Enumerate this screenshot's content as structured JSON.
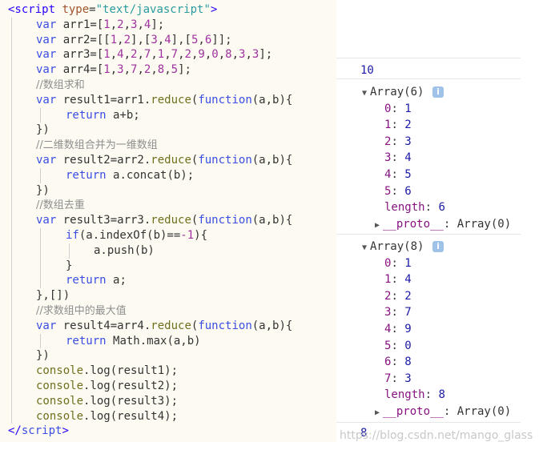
{
  "code": {
    "lines": [
      [
        [
          "tag",
          "<script "
        ],
        [
          "attr",
          "type"
        ],
        [
          "plain",
          "="
        ],
        [
          "str",
          "\"text/javascript\""
        ],
        [
          "tag",
          ">"
        ]
      ],
      [
        [
          "kw",
          "var "
        ],
        [
          "plain",
          "arr1=["
        ],
        [
          "num",
          "1"
        ],
        [
          "plain",
          ","
        ],
        [
          "num",
          "2"
        ],
        [
          "plain",
          ","
        ],
        [
          "num",
          "3"
        ],
        [
          "plain",
          ","
        ],
        [
          "num",
          "4"
        ],
        [
          "plain",
          "];"
        ]
      ],
      [
        [
          "kw",
          "var "
        ],
        [
          "plain",
          "arr2=[["
        ],
        [
          "num",
          "1"
        ],
        [
          "plain",
          ","
        ],
        [
          "num",
          "2"
        ],
        [
          "plain",
          "],["
        ],
        [
          "num",
          "3"
        ],
        [
          "plain",
          ","
        ],
        [
          "num",
          "4"
        ],
        [
          "plain",
          "],["
        ],
        [
          "num",
          "5"
        ],
        [
          "plain",
          ","
        ],
        [
          "num",
          "6"
        ],
        [
          "plain",
          "]];"
        ]
      ],
      [
        [
          "kw",
          "var "
        ],
        [
          "plain",
          "arr3=["
        ],
        [
          "num",
          "1"
        ],
        [
          "plain",
          ","
        ],
        [
          "num",
          "4"
        ],
        [
          "plain",
          ","
        ],
        [
          "num",
          "2"
        ],
        [
          "plain",
          ","
        ],
        [
          "num",
          "7"
        ],
        [
          "plain",
          ","
        ],
        [
          "num",
          "1"
        ],
        [
          "plain",
          ","
        ],
        [
          "num",
          "7"
        ],
        [
          "plain",
          ","
        ],
        [
          "num",
          "2"
        ],
        [
          "plain",
          ","
        ],
        [
          "num",
          "9"
        ],
        [
          "plain",
          ","
        ],
        [
          "num",
          "0"
        ],
        [
          "plain",
          ","
        ],
        [
          "num",
          "8"
        ],
        [
          "plain",
          ","
        ],
        [
          "num",
          "3"
        ],
        [
          "plain",
          ","
        ],
        [
          "num",
          "3"
        ],
        [
          "plain",
          "];"
        ]
      ],
      [
        [
          "kw",
          "var "
        ],
        [
          "plain",
          "arr4=["
        ],
        [
          "num",
          "1"
        ],
        [
          "plain",
          ","
        ],
        [
          "num",
          "3"
        ],
        [
          "plain",
          ","
        ],
        [
          "num",
          "7"
        ],
        [
          "plain",
          ","
        ],
        [
          "num",
          "2"
        ],
        [
          "plain",
          ","
        ],
        [
          "num",
          "8"
        ],
        [
          "plain",
          ","
        ],
        [
          "num",
          "5"
        ],
        [
          "plain",
          "];"
        ]
      ],
      [
        [
          "cm",
          "//数组求和"
        ]
      ],
      [
        [
          "kw",
          "var "
        ],
        [
          "plain",
          "result1=arr1."
        ],
        [
          "fn",
          "reduce"
        ],
        [
          "plain",
          "("
        ],
        [
          "kw",
          "function"
        ],
        [
          "plain",
          "(a,b){"
        ]
      ],
      [
        [
          "kw",
          "return "
        ],
        [
          "plain",
          "a+b;"
        ]
      ],
      [
        [
          "plain",
          "})"
        ]
      ],
      [
        [
          "cm",
          "//二维数组合并为一维数组"
        ]
      ],
      [
        [
          "kw",
          "var "
        ],
        [
          "plain",
          "result2=arr2."
        ],
        [
          "fn",
          "reduce"
        ],
        [
          "plain",
          "("
        ],
        [
          "kw",
          "function"
        ],
        [
          "plain",
          "(a,b){"
        ]
      ],
      [
        [
          "kw",
          "return "
        ],
        [
          "plain",
          "a.concat(b);"
        ]
      ],
      [
        [
          "plain",
          "})"
        ]
      ],
      [
        [
          "cm",
          "//数组去重"
        ]
      ],
      [
        [
          "kw",
          "var "
        ],
        [
          "plain",
          "result3=arr3."
        ],
        [
          "fn",
          "reduce"
        ],
        [
          "plain",
          "("
        ],
        [
          "kw",
          "function"
        ],
        [
          "plain",
          "(a,b){"
        ]
      ],
      [
        [
          "kw",
          "if"
        ],
        [
          "plain",
          "(a.indexOf(b)=="
        ],
        [
          "num",
          "-1"
        ],
        [
          "plain",
          "){"
        ]
      ],
      [
        [
          "plain",
          "a.push(b)"
        ]
      ],
      [
        [
          "plain",
          "}"
        ]
      ],
      [
        [
          "kw",
          "return "
        ],
        [
          "plain",
          "a;"
        ]
      ],
      [
        [
          "plain",
          "},[])"
        ]
      ],
      [
        [
          "cm",
          "//求数组中的最大值"
        ]
      ],
      [
        [
          "kw",
          "var "
        ],
        [
          "plain",
          "result4=arr4."
        ],
        [
          "fn",
          "reduce"
        ],
        [
          "plain",
          "("
        ],
        [
          "kw",
          "function"
        ],
        [
          "plain",
          "(a,b){"
        ]
      ],
      [
        [
          "kw",
          "return "
        ],
        [
          "plain",
          "Math.max(a,b)"
        ]
      ],
      [
        [
          "plain",
          "})"
        ]
      ],
      [
        [
          "fn",
          "console"
        ],
        [
          "plain",
          ".log(result1);"
        ]
      ],
      [
        [
          "fn",
          "console"
        ],
        [
          "plain",
          ".log(result2);"
        ]
      ],
      [
        [
          "fn",
          "console"
        ],
        [
          "plain",
          ".log(result3);"
        ]
      ],
      [
        [
          "fn",
          "console"
        ],
        [
          "plain",
          ".log(result4);"
        ]
      ],
      [
        [
          "tag",
          "</"
        ],
        [
          "kw",
          "script"
        ],
        [
          "tag",
          ">"
        ]
      ]
    ]
  },
  "console": {
    "result1": "10",
    "array1": {
      "summary": "Array(6)",
      "info_icon": "i",
      "items": [
        {
          "key": "0",
          "value": "1"
        },
        {
          "key": "1",
          "value": "2"
        },
        {
          "key": "2",
          "value": "3"
        },
        {
          "key": "3",
          "value": "4"
        },
        {
          "key": "4",
          "value": "5"
        },
        {
          "key": "5",
          "value": "6"
        }
      ],
      "length_label": "length",
      "length_value": "6",
      "proto_label": "__proto__",
      "proto_value": "Array(0)"
    },
    "array2": {
      "summary": "Array(8)",
      "info_icon": "i",
      "items": [
        {
          "key": "0",
          "value": "1"
        },
        {
          "key": "1",
          "value": "4"
        },
        {
          "key": "2",
          "value": "2"
        },
        {
          "key": "3",
          "value": "7"
        },
        {
          "key": "4",
          "value": "9"
        },
        {
          "key": "5",
          "value": "0"
        },
        {
          "key": "6",
          "value": "8"
        },
        {
          "key": "7",
          "value": "3"
        }
      ],
      "length_label": "length",
      "length_value": "8",
      "proto_label": "__proto__",
      "proto_value": "Array(0)"
    },
    "result4": "8",
    "expand_icon": "expanded-triangle-icon",
    "collapse_icon": "collapsed-triangle-icon"
  },
  "watermark": "https://blog.csdn.net/mango_glass"
}
